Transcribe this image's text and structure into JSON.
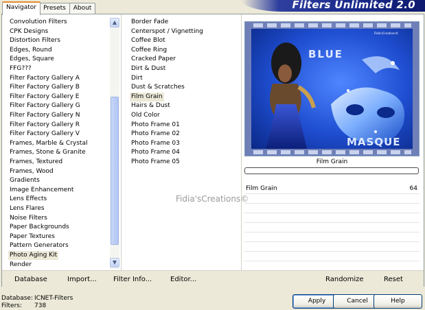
{
  "tabs": [
    "Navigator",
    "Presets",
    "About"
  ],
  "app_title": "Filters Unlimited 2.0",
  "categories": [
    "Convolution Filters",
    "CPK Designs",
    "Distortion Filters",
    "Edges, Round",
    "Edges, Square",
    "FFG???",
    "Filter Factory Gallery A",
    "Filter Factory Gallery B",
    "Filter Factory Gallery E",
    "Filter Factory Gallery G",
    "Filter Factory Gallery N",
    "Filter Factory Gallery R",
    "Filter Factory Gallery V",
    "Frames, Marble & Crystal",
    "Frames, Stone & Granite",
    "Frames, Textured",
    "Frames, Wood",
    "Gradients",
    "Image Enhancement",
    "Lens Effects",
    "Lens Flares",
    "Noise Filters",
    "Paper Backgrounds",
    "Paper Textures",
    "Pattern Generators",
    "Photo Aging Kit",
    "Render"
  ],
  "selected_category": "Photo Aging Kit",
  "filters": [
    "Border Fade",
    "Centerspot / Vignetting",
    "Coffee Blot",
    "Coffee Ring",
    "Cracked Paper",
    "Dirt & Dust",
    "Dirt",
    "Dust & Scratches",
    "Film Grain",
    "Hairs & Dust",
    "Old Color",
    "Photo Frame 01",
    "Photo Frame 02",
    "Photo Frame 03",
    "Photo Frame 04",
    "Photo Frame 05"
  ],
  "selected_filter": "Film Grain",
  "watermark": "Fidia'sCreations©",
  "preview": {
    "title_line1": "BLUE",
    "title_line2": "MASQUE",
    "signature": "Fidia'sCreations©"
  },
  "filter_label": "Film Grain",
  "param": {
    "name": "Film Grain",
    "value": "64"
  },
  "toolbar": {
    "database": "Database",
    "import": "Import...",
    "filter_info": "Filter Info...",
    "editor": "Editor...",
    "randomize": "Randomize",
    "reset": "Reset"
  },
  "status": {
    "database_label": "Database:",
    "database_value": "ICNET-Filters",
    "filters_label": "Filters:",
    "filters_value": "738"
  },
  "buttons": {
    "apply": "Apply",
    "cancel": "Cancel",
    "help": "Help"
  },
  "colors": {
    "preview_blue": "#1b46b7",
    "tab_accent": "#e68b2c",
    "banner_blue": "#1a2a8c"
  }
}
